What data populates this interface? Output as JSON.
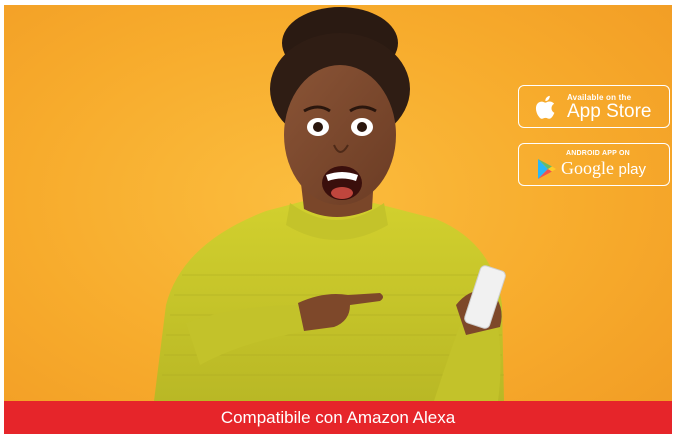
{
  "store_badges": {
    "app_store": {
      "small_text": "Available on the",
      "large_text": "App Store",
      "icon": "apple-icon"
    },
    "google_play": {
      "small_text": "ANDROID APP ON",
      "large_text_brand": "Google",
      "large_text_product": "play",
      "icon": "google-play-icon"
    }
  },
  "caption": {
    "text": "Compatibile con Amazon Alexa",
    "background_color": "#e6252a"
  },
  "colors": {
    "background": "#f7ab2c",
    "sweater": "#c9c92a",
    "accent_red": "#e6252a"
  }
}
